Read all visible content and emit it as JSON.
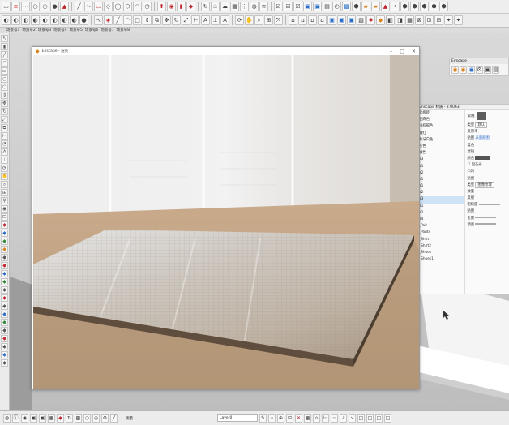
{
  "toolbar_tabs": [
    "场景号1",
    "场景号2",
    "场景号3",
    "场景号4",
    "场景号5",
    "场景号6",
    "场景号7",
    "场景号8"
  ],
  "enscape_window": {
    "title": "Enscape - 渲染"
  },
  "enscape_toolbar": {
    "title": "Enscape"
  },
  "material_panel": {
    "title": "Enscape 材质 - 3.0063",
    "tab_label": "常规",
    "materials": [
      "云板砖",
      "亚麻色",
      "浅棕褐色",
      "橘红",
      "象牙白色",
      "灰色",
      "橘色",
      "a3",
      "a1",
      "a2",
      "a1",
      "a1",
      "a2",
      "a3",
      "a1",
      "a2",
      "a4",
      "_Pair",
      "_Pants",
      "_Shirt",
      "_Shirt2",
      "_Shoes",
      "_Shoes1"
    ],
    "props_left": [
      "类型",
      "反照率",
      "贴图",
      "着色",
      "滤镜",
      "颜色",
      "",
      "凸凹",
      "贴图",
      "类型",
      "数量",
      "反射",
      "粗糙度",
      "贴图",
      "金属",
      "镜面"
    ],
    "props_values": {
      "type": "默认",
      "map": "表面贴图",
      "bump_type": "图像纹理",
      "tex_checkbox": "固态光"
    }
  },
  "status_bar": {
    "layer": "Layer0",
    "measure_label": "测量"
  },
  "colors": {
    "floor": "#bfa282",
    "slab": "#a48a6c",
    "accent": "#2c6fc9"
  }
}
